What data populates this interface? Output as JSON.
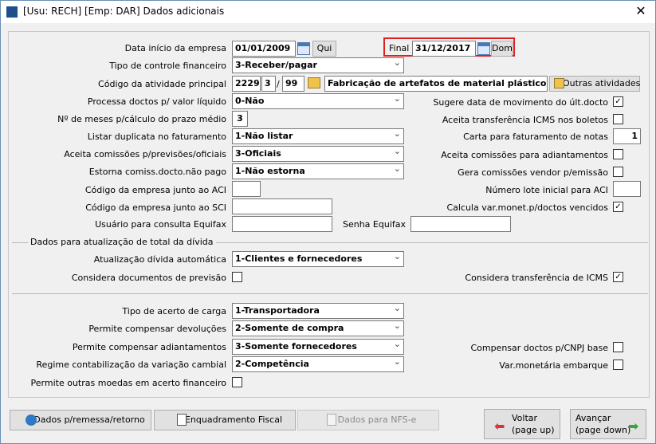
{
  "window": {
    "title": "[Usu: RECH] [Emp: DAR] Dados adicionais",
    "close": "✕"
  },
  "fields": {
    "data_inicio": {
      "label": "Data início da empresa",
      "value": "01/01/2009",
      "day": "Qui"
    },
    "data_final": {
      "label": "Final",
      "value": "31/12/2017",
      "day": "Dom"
    },
    "tipo_controle": {
      "label": "Tipo de controle financeiro",
      "value": "3-Receber/pagar"
    },
    "codigo_atividade": {
      "label": "Código da atividade principal",
      "p1": "2229",
      "p2": "3",
      "slash": "/",
      "p3": "99",
      "desc": "Fabricação de artefatos de material plástico para",
      "outras": "Outras atividades"
    },
    "processa_doctos": {
      "label": "Processa doctos p/ valor líquido",
      "value": "0-Não"
    },
    "num_meses": {
      "label": "Nº de meses p/cálculo do prazo médio",
      "value": "3"
    },
    "listar_duplicata": {
      "label": "Listar duplicata no faturamento",
      "value": "1-Não listar"
    },
    "aceita_comissoes": {
      "label": "Aceita comissões p/previsões/oficiais",
      "value": "3-Oficiais"
    },
    "estorna_comiss": {
      "label": "Estorna comiss.docto.não pago",
      "value": "1-Não estorna"
    },
    "codigo_aci": {
      "label": "Código da empresa junto ao ACI",
      "value": ""
    },
    "codigo_sci": {
      "label": "Código da empresa junto ao SCI",
      "value": ""
    },
    "usuario_equifax": {
      "label": "Usuário para consulta Equifax",
      "value": ""
    },
    "senha_equifax": {
      "label": "Senha Equifax",
      "value": ""
    }
  },
  "right": {
    "sugere_data": {
      "label": "Sugere data de movimento do últ.docto",
      "checked": true
    },
    "aceita_transf_icms": {
      "label": "Aceita transferência ICMS nos boletos",
      "checked": false
    },
    "carta_faturamento": {
      "label": "Carta para faturamento de notas",
      "value": "1"
    },
    "aceita_comiss_adiant": {
      "label": "Aceita comissões para adiantamentos",
      "checked": false
    },
    "gera_comissoes": {
      "label": "Gera comissões vendor p/emissão",
      "checked": false
    },
    "numero_lote": {
      "label": "Número lote inicial para ACI",
      "value": ""
    },
    "calcula_var": {
      "label": "Calcula var.monet.p/doctos vencidos",
      "checked": true
    }
  },
  "divida": {
    "section_title": "Dados para atualização de total da dívida",
    "atualizacao": {
      "label": "Atualização dívida automática",
      "value": "1-Clientes e fornecedores"
    },
    "considera_docs": {
      "label": "Considera documentos de previsão",
      "checked": false
    },
    "considera_transf": {
      "label": "Considera transferência de ICMS",
      "checked": true
    }
  },
  "carga": {
    "tipo_acerto": {
      "label": "Tipo de acerto de carga",
      "value": "1-Transportadora"
    },
    "permite_devol": {
      "label": "Permite compensar devoluções",
      "value": "2-Somente de compra"
    },
    "permite_adiant": {
      "label": "Permite compensar adiantamentos",
      "value": "3-Somente fornecedores"
    },
    "regime": {
      "label": "Regime contabilização da variação cambial",
      "value": "2-Competência"
    },
    "outras_moedas": {
      "label": "Permite outras moedas em acerto financeiro",
      "checked": false
    },
    "compensar_cnpj": {
      "label": "Compensar doctos p/CNPJ base",
      "checked": false
    },
    "var_embarque": {
      "label": "Var.monetária embarque",
      "checked": false
    }
  },
  "buttons": {
    "dados_remessa": "Dados p/remessa/retorno",
    "enquadramento": "Enquadramento Fiscal",
    "dados_nfse": "Dados para NFS-e",
    "voltar": "Voltar",
    "voltar_sub": "(page up)",
    "avancar": "Avançar",
    "avancar_sub": "(page down)"
  },
  "colors": {
    "highlight": "#e02020",
    "back_arrow": "#d9343a",
    "forward_arrow": "#3aa53a"
  }
}
